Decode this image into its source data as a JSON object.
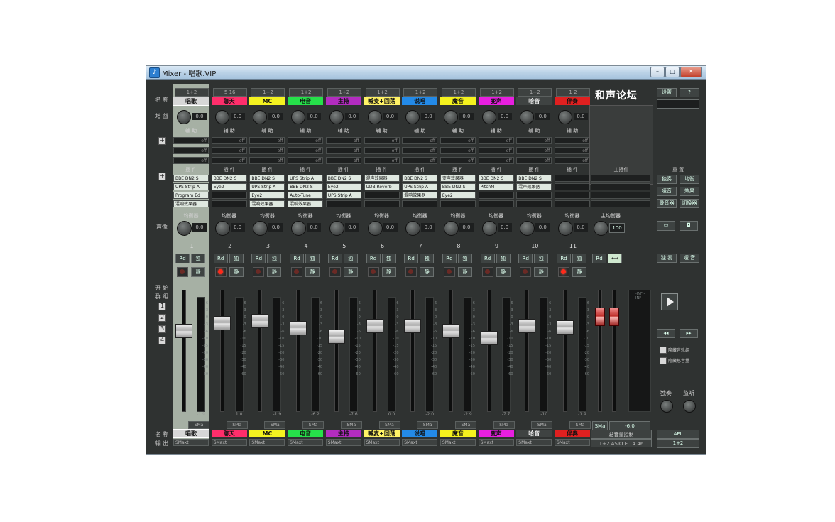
{
  "window": {
    "title": "Mixer - 唱歌.VIP",
    "icon": "mixer-app-icon",
    "buttons": [
      "–",
      "□",
      "✕"
    ]
  },
  "brand": "和声论坛",
  "row_labels": {
    "name": "名 称",
    "gain": "增 益",
    "aux": "辅 助",
    "inserts": "插 件",
    "eq": "均衡器",
    "pan": "声像",
    "mixer_label": "开 始",
    "group": "群 组",
    "name_bottom": "名 称",
    "output": "输 出"
  },
  "channels": [
    {
      "num": "1",
      "name": "唱歌",
      "color": "#d7d7d7",
      "input": "1+2",
      "gain": "0.0",
      "pan": "0.0",
      "inserts": [
        "BBE DN2 S",
        "UPS Strip A",
        "Program Ed",
        "混响效果器"
      ],
      "rec_on": false,
      "fader_pos": 0.28,
      "value": "-1.9",
      "out": "SMaxt"
    },
    {
      "num": "2",
      "name": "聊天",
      "color": "#ff2e6b",
      "input": "5 16",
      "gain": "0.0",
      "pan": "0.0",
      "inserts": [
        "BBE DN2 S",
        "Eye2",
        "",
        ""
      ],
      "rec_on": true,
      "fader_pos": 0.22,
      "value": "1.0",
      "out": "SMaxt"
    },
    {
      "num": "3",
      "name": "MC",
      "color": "#f4f220",
      "input": "1+2",
      "gain": "0.0",
      "pan": "0.0",
      "inserts": [
        "BBE DN2 S",
        "UPS Strip A",
        "Eye2",
        "混响效果器"
      ],
      "rec_on": false,
      "fader_pos": 0.2,
      "value": "-1.9",
      "out": "SMaxt"
    },
    {
      "num": "4",
      "name": "电音",
      "color": "#26e04a",
      "input": "1+2",
      "gain": "0.0",
      "pan": "0.0",
      "inserts": [
        "UPS Strip A",
        "BBE DN2 S",
        "Auto-Tune",
        "混响效果器"
      ],
      "rec_on": false,
      "fader_pos": 0.26,
      "value": "-6.2",
      "out": "SMaxt"
    },
    {
      "num": "5",
      "name": "主持",
      "color": "#b32cc0",
      "input": "1+2",
      "gain": "0.0",
      "pan": "0.0",
      "inserts": [
        "BBE DN2 S",
        "Eye2",
        "UPS Strip A",
        ""
      ],
      "rec_on": false,
      "fader_pos": 0.33,
      "value": "-7.6",
      "out": "SMaxt"
    },
    {
      "num": "6",
      "name": "喊麦+回荡",
      "color": "#fff266",
      "input": "1+2",
      "gain": "0.0",
      "pan": "0.0",
      "inserts": [
        "混声效果器",
        "UDB Reverb",
        "",
        ""
      ],
      "rec_on": false,
      "fader_pos": 0.24,
      "value": "0.0",
      "out": "SMaxt"
    },
    {
      "num": "7",
      "name": "说唱",
      "color": "#238ae8",
      "input": "1+2",
      "gain": "0.0",
      "pan": "0.0",
      "inserts": [
        "BBE DN2 S",
        "UPS Strip A",
        "混响效果器",
        ""
      ],
      "rec_on": false,
      "fader_pos": 0.24,
      "value": "-2.0",
      "out": "SMaxt"
    },
    {
      "num": "8",
      "name": "魔音",
      "color": "#f5f21e",
      "input": "1+2",
      "gain": "0.0",
      "pan": "0.0",
      "inserts": [
        "变声效果器",
        "BBE DN2 S",
        "Eye2",
        ""
      ],
      "rec_on": false,
      "fader_pos": 0.28,
      "value": "-2.9",
      "out": "SMaxt"
    },
    {
      "num": "9",
      "name": "变声",
      "color": "#e81fe0",
      "input": "1+2",
      "gain": "0.0",
      "pan": "0.0",
      "inserts": [
        "BBE DN2 S",
        "PitchM",
        "",
        ""
      ],
      "rec_on": false,
      "fader_pos": 0.34,
      "value": "-7.7",
      "out": "SMaxt"
    },
    {
      "num": "10",
      "name": "哈音",
      "color": "#3f4342",
      "input": "1+2",
      "gain": "0.0",
      "pan": "0.0",
      "inserts": [
        "BBE DN2 S",
        "混声效果器",
        "",
        ""
      ],
      "rec_on": false,
      "fader_pos": 0.24,
      "value": "-10",
      "out": "SMaxt"
    },
    {
      "num": "11",
      "name": "伴奏",
      "color": "#e02020",
      "input": "1 2",
      "gain": "0.0",
      "pan": "0.0",
      "inserts": [
        "",
        "",
        "",
        ""
      ],
      "rec_on": true,
      "fader_pos": 0.25,
      "value": "-1.9",
      "out": "SMaxt"
    }
  ],
  "master": {
    "label_inserts": "主插件",
    "label_eq": "主均衡器",
    "pan": "100",
    "name": "总音量控制",
    "output": "1+2 ASIO E...4 46",
    "fader_value": "-6.0",
    "meter_range": "-INF  -INF"
  },
  "right_panel": {
    "top_buttons": [
      "设置",
      "?"
    ],
    "section_label": "重 置",
    "function_buttons": [
      "独奏",
      "均衡",
      "哑音",
      "效果",
      "录音器",
      "切换器"
    ],
    "solo_label": "独 奏",
    "mute_label": "哑 音",
    "checkboxes": [
      "隐藏音轨组",
      "隐藏总音量"
    ],
    "knobs": [
      "独奏",
      "监听"
    ],
    "afl": "AFL",
    "out": "1+2"
  }
}
